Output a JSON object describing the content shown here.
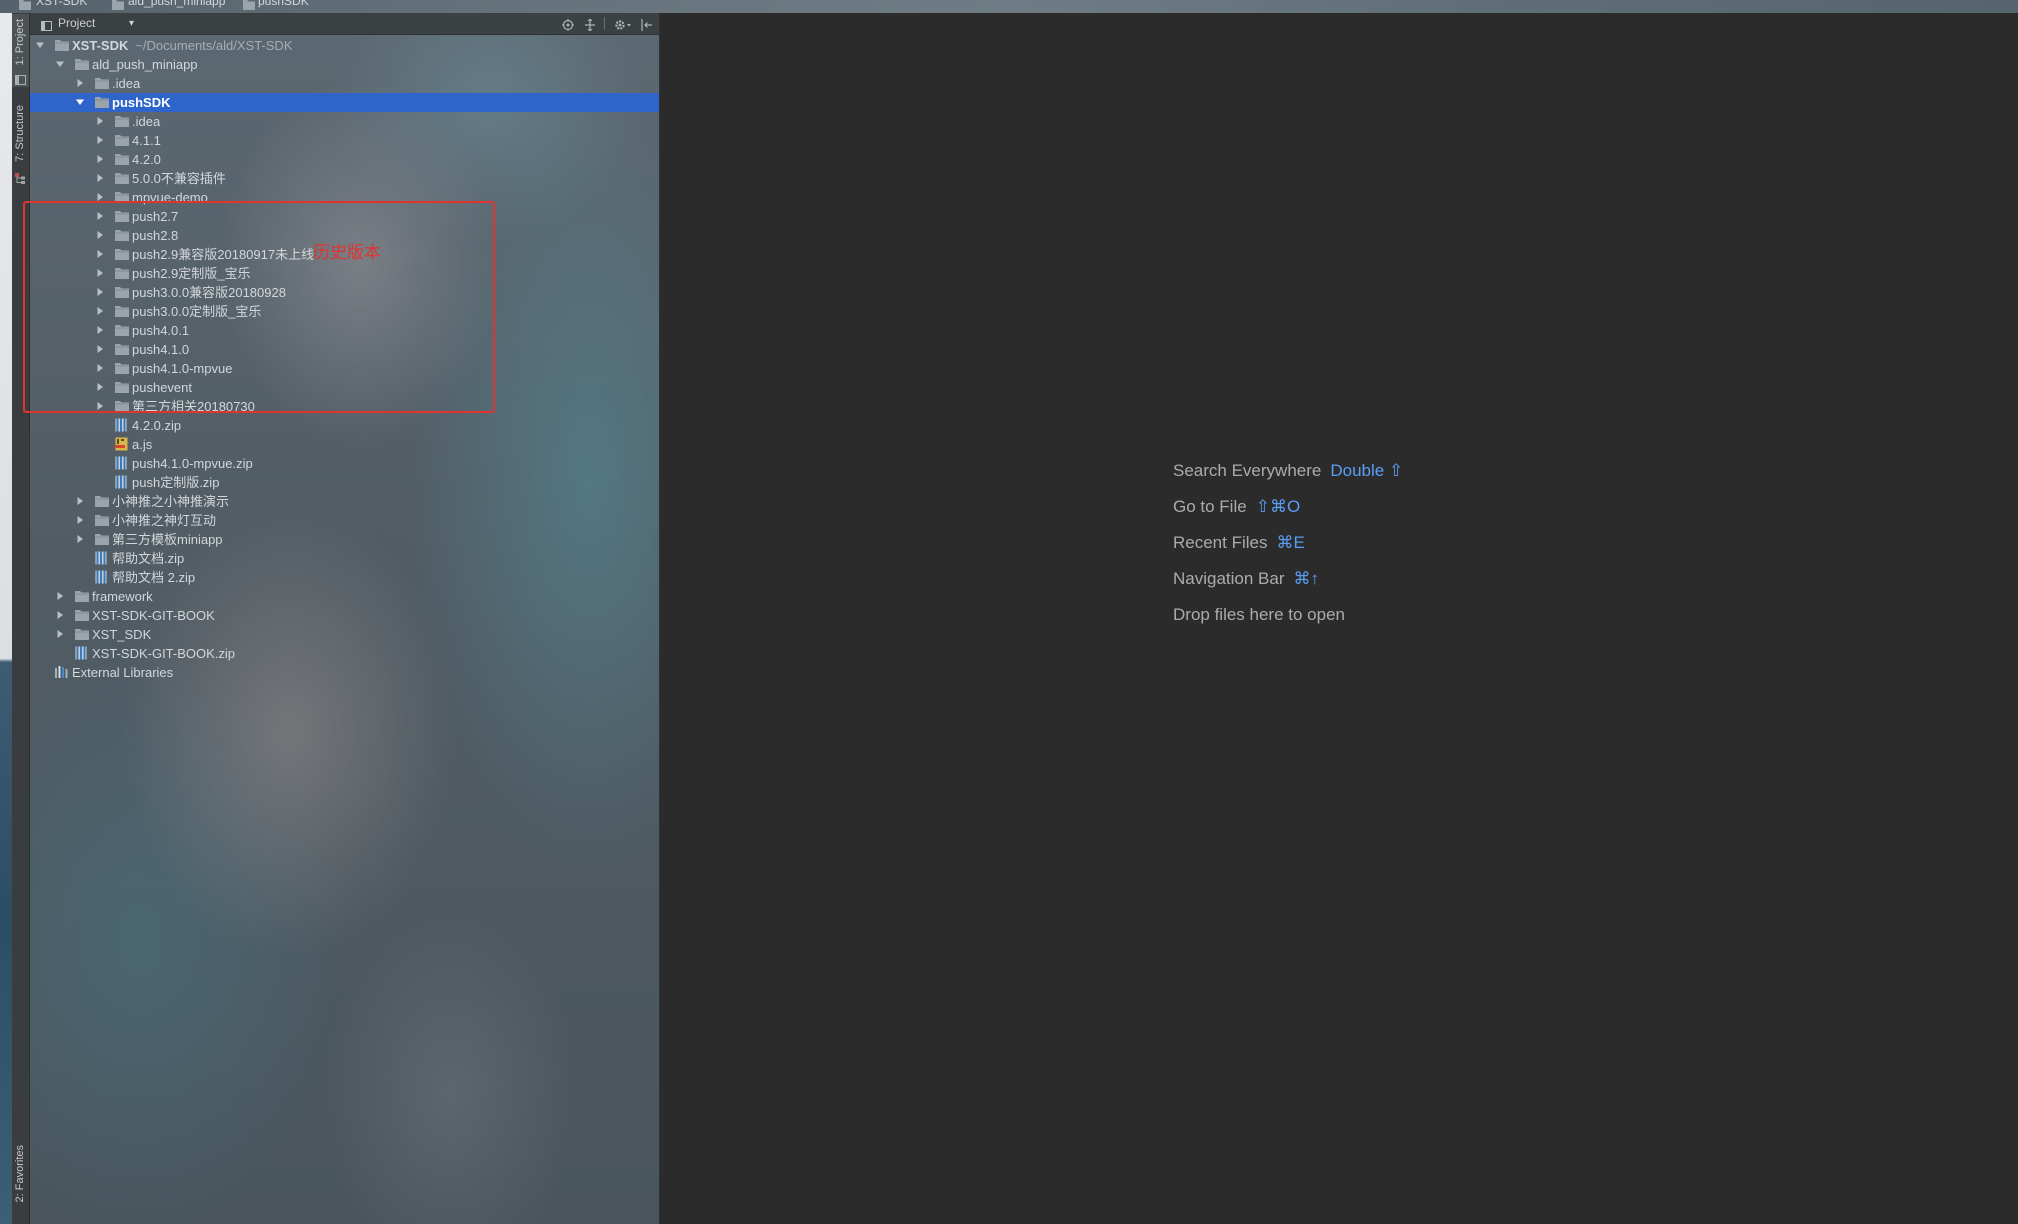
{
  "breadcrumb": [
    {
      "label": "XST-SDK",
      "icon": "folder-icon"
    },
    {
      "label": "ald_push_miniapp",
      "icon": "folder-icon"
    },
    {
      "label": "pushSDK",
      "icon": "folder-icon"
    }
  ],
  "tool_stripe": {
    "project_label": "1: Project",
    "structure_label": "7: Structure",
    "favorites_label": "2: Favorites"
  },
  "project_panel": {
    "title": "Project",
    "header_icons": [
      "project-view-icon",
      "locate-icon",
      "collapse-all-icon",
      "settings-gear-icon",
      "hide-panel-icon"
    ],
    "tree": [
      {
        "label": "XST-SDK",
        "suffix": "~/Documents/ald/XST-SDK",
        "level": 0,
        "type": "folder",
        "expanded": true,
        "bold": true
      },
      {
        "label": "ald_push_miniapp",
        "level": 1,
        "type": "folder",
        "expanded": true
      },
      {
        "label": ".idea",
        "level": 2,
        "type": "folder",
        "expanded": false
      },
      {
        "label": "pushSDK",
        "level": 2,
        "type": "folder",
        "expanded": true,
        "selected": true,
        "bold": true
      },
      {
        "label": ".idea",
        "level": 3,
        "type": "folder",
        "expanded": false
      },
      {
        "label": "4.1.1",
        "level": 3,
        "type": "folder",
        "expanded": false
      },
      {
        "label": "4.2.0",
        "level": 3,
        "type": "folder",
        "expanded": false
      },
      {
        "label": "5.0.0不兼容插件",
        "level": 3,
        "type": "folder",
        "expanded": false
      },
      {
        "label": "mpvue-demo",
        "level": 3,
        "type": "folder",
        "expanded": false
      },
      {
        "label": "push2.7",
        "level": 3,
        "type": "folder",
        "expanded": false
      },
      {
        "label": "push2.8",
        "level": 3,
        "type": "folder",
        "expanded": false
      },
      {
        "label": "push2.9兼容版20180917未上线",
        "level": 3,
        "type": "folder",
        "expanded": false
      },
      {
        "label": "push2.9定制版_宝乐",
        "level": 3,
        "type": "folder",
        "expanded": false
      },
      {
        "label": "push3.0.0兼容版20180928",
        "level": 3,
        "type": "folder",
        "expanded": false
      },
      {
        "label": "push3.0.0定制版_宝乐",
        "level": 3,
        "type": "folder",
        "expanded": false
      },
      {
        "label": "push4.0.1",
        "level": 3,
        "type": "folder",
        "expanded": false
      },
      {
        "label": "push4.1.0",
        "level": 3,
        "type": "folder",
        "expanded": false
      },
      {
        "label": "push4.1.0-mpvue",
        "level": 3,
        "type": "folder",
        "expanded": false
      },
      {
        "label": "pushevent",
        "level": 3,
        "type": "folder",
        "expanded": false
      },
      {
        "label": "第三方相关20180730",
        "level": 3,
        "type": "folder",
        "expanded": false
      },
      {
        "label": "4.2.0.zip",
        "level": 3,
        "type": "zip"
      },
      {
        "label": "a.js",
        "level": 3,
        "type": "js"
      },
      {
        "label": "push4.1.0-mpvue.zip",
        "level": 3,
        "type": "zip"
      },
      {
        "label": "push定制版.zip",
        "level": 3,
        "type": "zip"
      },
      {
        "label": "小神推之小神推演示",
        "level": 2,
        "type": "folder",
        "expanded": false
      },
      {
        "label": "小神推之神灯互动",
        "level": 2,
        "type": "folder",
        "expanded": false
      },
      {
        "label": "第三方模板miniapp",
        "level": 2,
        "type": "folder",
        "expanded": false
      },
      {
        "label": "帮助文档.zip",
        "level": 2,
        "type": "zip"
      },
      {
        "label": "帮助文档 2.zip",
        "level": 2,
        "type": "zip"
      },
      {
        "label": "framework",
        "level": 1,
        "type": "folder",
        "expanded": false
      },
      {
        "label": "XST-SDK-GIT-BOOK",
        "level": 1,
        "type": "folder",
        "expanded": false
      },
      {
        "label": "XST_SDK",
        "level": 1,
        "type": "folder",
        "expanded": false
      },
      {
        "label": "XST-SDK-GIT-BOOK.zip",
        "level": 1,
        "type": "zip"
      },
      {
        "label": "External Libraries",
        "level": 0,
        "type": "library"
      }
    ]
  },
  "annotation": {
    "text": "历史版本",
    "color": "#e0342f"
  },
  "editor": {
    "hints": [
      {
        "label": "Search Everywhere",
        "shortcut": "Double ⇧"
      },
      {
        "label": "Go to File",
        "shortcut": "⇧⌘O"
      },
      {
        "label": "Recent Files",
        "shortcut": "⌘E"
      },
      {
        "label": "Navigation Bar",
        "shortcut": "⌘↑"
      }
    ],
    "drop_hint": "Drop files here to open"
  },
  "colors": {
    "editor_bg": "#2b2b2b",
    "selection": "#2f65ca",
    "hint_text": "#a9acae",
    "shortcut_text": "#5b9ef5",
    "annotation": "#e0342f"
  }
}
